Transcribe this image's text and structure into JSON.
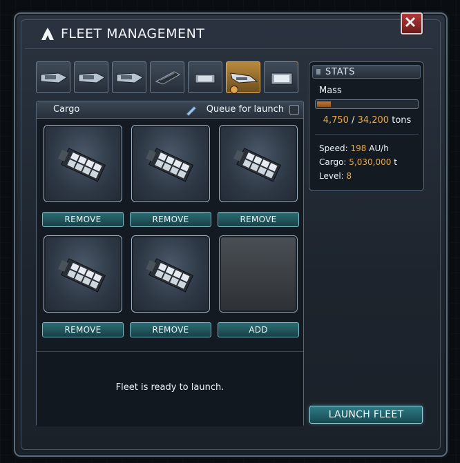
{
  "window": {
    "title": "FLEET MANAGEMENT"
  },
  "ship_tabs": [
    {
      "icon": "ship-icon",
      "active": false
    },
    {
      "icon": "ship-icon",
      "active": false
    },
    {
      "icon": "ship-icon",
      "active": false
    },
    {
      "icon": "ship-icon",
      "active": false
    },
    {
      "icon": "ship-icon",
      "active": false
    },
    {
      "icon": "ship-icon",
      "active": true
    },
    {
      "icon": "ship-icon",
      "active": false
    }
  ],
  "cargo_panel": {
    "label": "Cargo",
    "queue_label": "Queue for launch",
    "slots": [
      {
        "filled": true,
        "button": "REMOVE"
      },
      {
        "filled": true,
        "button": "REMOVE"
      },
      {
        "filled": true,
        "button": "REMOVE"
      },
      {
        "filled": true,
        "button": "REMOVE"
      },
      {
        "filled": true,
        "button": "REMOVE"
      },
      {
        "filled": false,
        "button": "ADD"
      }
    ],
    "status": "Fleet is ready to launch."
  },
  "stats": {
    "title": "STATS",
    "mass_label": "Mass",
    "mass_current": "4,750",
    "mass_separator": "/",
    "mass_max": "34,200",
    "mass_unit": "tons",
    "mass_fraction": 0.139,
    "speed_label": "Speed:",
    "speed_value": "198",
    "speed_unit": "AU/h",
    "cargo_label": "Cargo:",
    "cargo_value": "5,030,000",
    "cargo_unit": "t",
    "level_label": "Level:",
    "level_value": "8"
  },
  "launch_button": "LAUNCH FLEET",
  "colors": {
    "accent": "#e9a94a",
    "button": "#2d6c74",
    "close": "#b23a3a"
  }
}
